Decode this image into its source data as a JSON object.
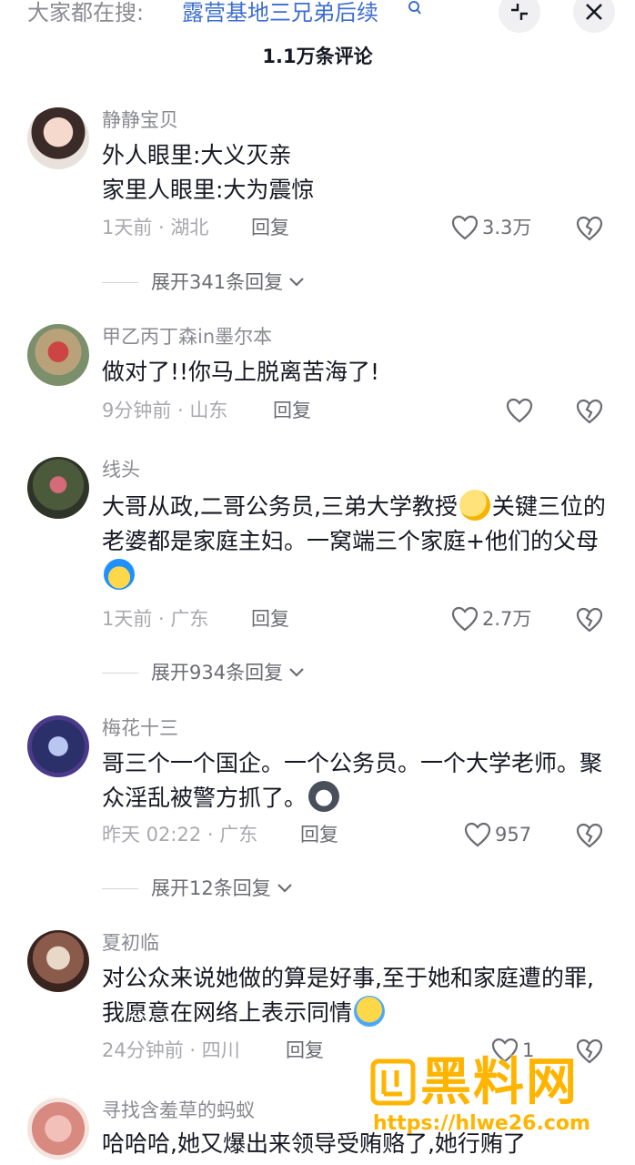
{
  "header": {
    "search_prefix": "大家都在搜:",
    "search_term": "露营基地三兄弟后续",
    "comment_count": "1.1万条评论"
  },
  "comments": [
    {
      "username": "静静宝贝",
      "text": "外人眼里:大义灭亲\n家里人眼里:大为震惊",
      "time_location": "1天前 · 湖北",
      "reply_label": "回复",
      "likes": "3.3万",
      "expand_label": "展开341条回复"
    },
    {
      "username": "甲乙丙丁森in墨尔本",
      "text": "做对了!!你马上脱离苦海了!",
      "time_location": "9分钟前 · 山东",
      "reply_label": "回复",
      "likes": ""
    },
    {
      "username": "线头",
      "text_part1": "大哥从政,二哥公务员,三弟大学教授",
      "text_part2": "关键三位的老婆都是家庭主妇。一窝端三个家庭+他们的父母",
      "time_location": "1天前 · 广东",
      "reply_label": "回复",
      "likes": "2.7万",
      "expand_label": "展开934条回复"
    },
    {
      "username": "梅花十三",
      "text": "哥三个一个国企。一个公务员。一个大学老师。聚众淫乱被警方抓了。",
      "time_location": "昨天 02:22 · 广东",
      "reply_label": "回复",
      "likes": "957",
      "expand_label": "展开12条回复"
    },
    {
      "username": "夏初临",
      "text": "对公众来说她做的算是好事,至于她和家庭遭的罪,我愿意在网络上表示同情",
      "time_location": "24分钟前 · 四川",
      "reply_label": "回复",
      "likes": "1"
    },
    {
      "username": "寻找含羞草的蚂蚁",
      "text": "哈哈哈,她又爆出来领导受贿赂了,她行贿了"
    }
  ],
  "watermark": {
    "title": "黑料网",
    "url": "https://hlwe26.com"
  },
  "colors": {
    "accent_link": "#3d6ecf",
    "watermark": "#ffb400"
  }
}
